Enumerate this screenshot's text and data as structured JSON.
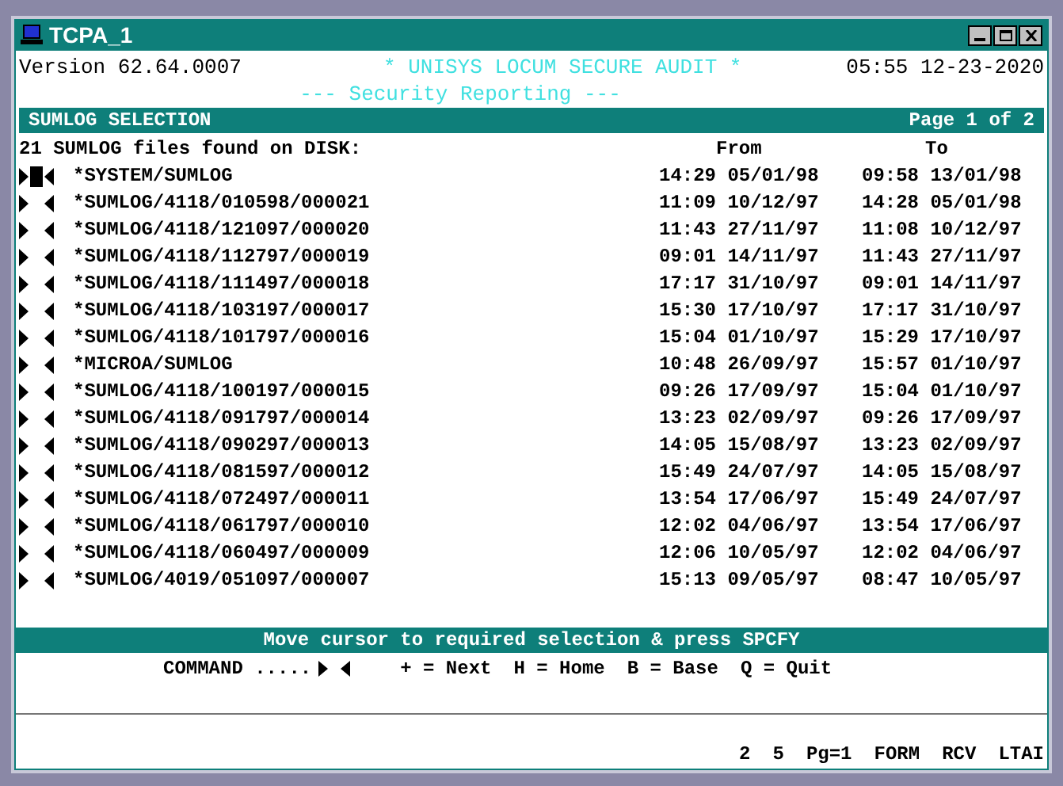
{
  "window": {
    "title": "TCPA_1"
  },
  "header": {
    "version": "Version 62.64.0007",
    "title": "* UNISYS LOCUM SECURE AUDIT *",
    "datetime": "05:55 12-23-2020",
    "subtitle": "--- Security Reporting ---"
  },
  "banner": {
    "title": "SUMLOG SELECTION",
    "page": "Page 1 of 2"
  },
  "list": {
    "summary": "21 SUMLOG files found on DISK:",
    "columns": [
      "From",
      "To"
    ],
    "rows": [
      {
        "name": "*SYSTEM/SUMLOG",
        "from": "14:29 05/01/98",
        "to": "09:58 13/01/98",
        "selected": true
      },
      {
        "name": "*SUMLOG/4118/010598/000021",
        "from": "11:09 10/12/97",
        "to": "14:28 05/01/98",
        "selected": false
      },
      {
        "name": "*SUMLOG/4118/121097/000020",
        "from": "11:43 27/11/97",
        "to": "11:08 10/12/97",
        "selected": false
      },
      {
        "name": "*SUMLOG/4118/112797/000019",
        "from": "09:01 14/11/97",
        "to": "11:43 27/11/97",
        "selected": false
      },
      {
        "name": "*SUMLOG/4118/111497/000018",
        "from": "17:17 31/10/97",
        "to": "09:01 14/11/97",
        "selected": false
      },
      {
        "name": "*SUMLOG/4118/103197/000017",
        "from": "15:30 17/10/97",
        "to": "17:17 31/10/97",
        "selected": false
      },
      {
        "name": "*SUMLOG/4118/101797/000016",
        "from": "15:04 01/10/97",
        "to": "15:29 17/10/97",
        "selected": false
      },
      {
        "name": "*MICROA/SUMLOG",
        "from": "10:48 26/09/97",
        "to": "15:57 01/10/97",
        "selected": false
      },
      {
        "name": "*SUMLOG/4118/100197/000015",
        "from": "09:26 17/09/97",
        "to": "15:04 01/10/97",
        "selected": false
      },
      {
        "name": "*SUMLOG/4118/091797/000014",
        "from": "13:23 02/09/97",
        "to": "09:26 17/09/97",
        "selected": false
      },
      {
        "name": "*SUMLOG/4118/090297/000013",
        "from": "14:05 15/08/97",
        "to": "13:23 02/09/97",
        "selected": false
      },
      {
        "name": "*SUMLOG/4118/081597/000012",
        "from": "15:49 24/07/97",
        "to": "14:05 15/08/97",
        "selected": false
      },
      {
        "name": "*SUMLOG/4118/072497/000011",
        "from": "13:54 17/06/97",
        "to": "15:49 24/07/97",
        "selected": false
      },
      {
        "name": "*SUMLOG/4118/061797/000010",
        "from": "12:02 04/06/97",
        "to": "13:54 17/06/97",
        "selected": false
      },
      {
        "name": "*SUMLOG/4118/060497/000009",
        "from": "12:06 10/05/97",
        "to": "12:02 04/06/97",
        "selected": false
      },
      {
        "name": "*SUMLOG/4019/051097/000007",
        "from": "15:13 09/05/97",
        "to": "08:47 10/05/97",
        "selected": false
      }
    ]
  },
  "prompt": "Move cursor to required selection & press SPCFY",
  "command": {
    "label": "COMMAND .....",
    "keys": [
      "+ = Next",
      "H = Home",
      "B = Base",
      "Q = Quit"
    ]
  },
  "status_bar": [
    "2",
    "5",
    "Pg=1",
    "FORM",
    "RCV",
    "LTAI"
  ]
}
